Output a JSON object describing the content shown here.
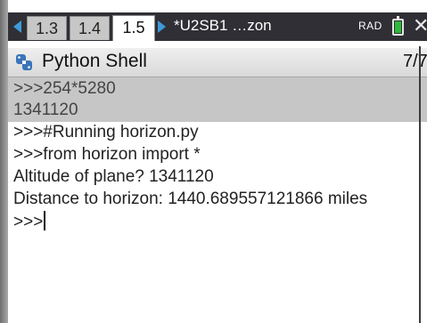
{
  "topbar": {
    "tabs": [
      {
        "label": "1.3",
        "active": false
      },
      {
        "label": "1.4",
        "active": false
      },
      {
        "label": "1.5",
        "active": true
      }
    ],
    "document_title": "*U2SB1 …zon",
    "angle_mode": "RAD",
    "battery_color": "#2dbb3a",
    "icons": [
      "arrow-left-icon",
      "arrow-right-icon",
      "battery-icon",
      "close-icon"
    ]
  },
  "app": {
    "icon": "python-icon",
    "title": "Python Shell",
    "page_count": "7/7"
  },
  "shell": {
    "lines": [
      {
        "text": ">>>254*5280",
        "highlighted": true
      },
      {
        "text": "1341120",
        "highlighted": true
      },
      {
        "text": ">>>#Running horizon.py",
        "highlighted": false
      },
      {
        "text": ">>>from horizon import *",
        "highlighted": false
      },
      {
        "text": "Altitude of plane? 1341120",
        "highlighted": false
      },
      {
        "text": "Distance to horizon:  1440.689557121866 miles",
        "highlighted": false
      }
    ],
    "prompt": ">>>"
  },
  "colors": {
    "accent": "#3f9ad9",
    "topbar_bg": "#2f2f35",
    "highlight_bg": "#c6c6c6"
  }
}
